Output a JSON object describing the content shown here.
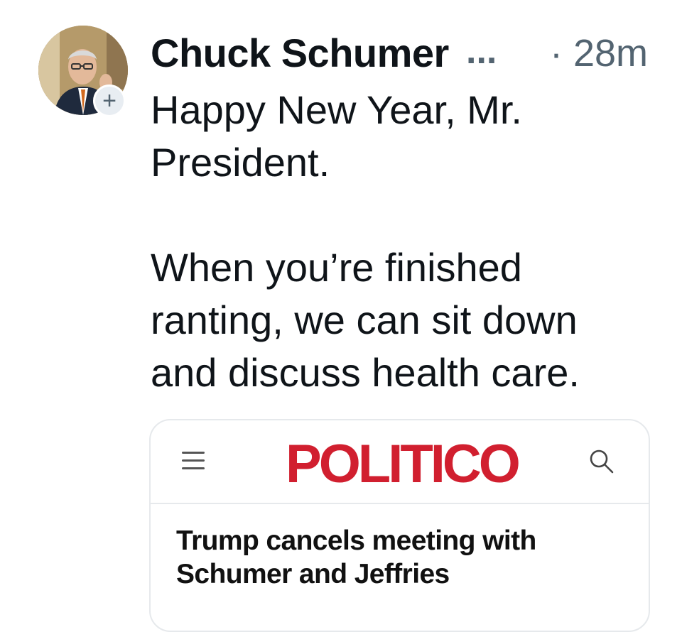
{
  "post": {
    "author": "Chuck Schumer",
    "author_truncation": "...",
    "timestamp": "· 28m",
    "follow_badge": "+",
    "body_paragraphs": [
      "Happy New Year, Mr. President.",
      "When you’re finished ranting, we can sit down and discuss health care."
    ]
  },
  "link_card": {
    "brand": "POLITICO",
    "brand_color": "#d11f2f",
    "menu_icon": "hamburger-menu-icon",
    "search_icon": "search-icon",
    "headline": "Trump cancels meeting with Schumer and Jeffries"
  }
}
